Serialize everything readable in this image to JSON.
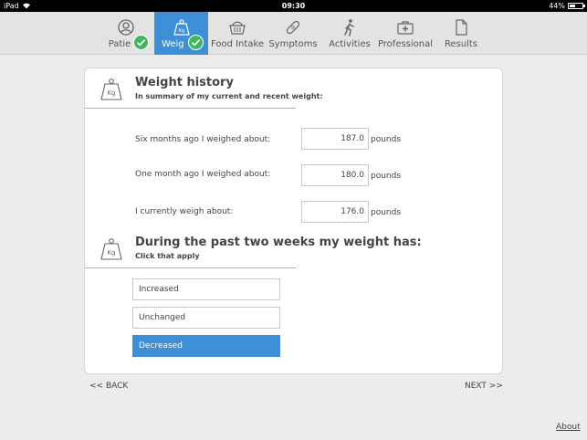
{
  "statusbar": {
    "device": "iPad",
    "time": "09:30",
    "battery": "44%"
  },
  "nav": {
    "tabs": [
      {
        "label": "Patie",
        "icon": "person-icon",
        "completed": true
      },
      {
        "label": "Weig",
        "icon": "weight-icon",
        "completed": true,
        "active": true
      },
      {
        "label": "Food Intake",
        "icon": "basket-icon"
      },
      {
        "label": "Symptoms",
        "icon": "bandage-icon"
      },
      {
        "label": "Activities",
        "icon": "walking-icon"
      },
      {
        "label": "Professional",
        "icon": "medical-kit-icon"
      },
      {
        "label": "Results",
        "icon": "document-icon"
      }
    ]
  },
  "weight_history": {
    "icon_text": "Kg",
    "title": "Weight history",
    "subtitle": "In summary of my current and recent weight:",
    "rows": [
      {
        "label": "Six months ago I weighed about:",
        "value": "187.0",
        "unit": "pounds"
      },
      {
        "label": "One month ago I weighed about:",
        "value": "180.0",
        "unit": "pounds"
      },
      {
        "label": "I currently weigh about:",
        "value": "176.0",
        "unit": "pounds"
      }
    ]
  },
  "weight_change": {
    "icon_text": "Kg",
    "title": "During the past two weeks my weight has:",
    "subtitle": "Click that apply",
    "options": [
      {
        "label": "Increased",
        "selected": false
      },
      {
        "label": "Unchanged",
        "selected": false
      },
      {
        "label": "Decreased",
        "selected": true
      }
    ]
  },
  "footer": {
    "back": "<< BACK",
    "next": "NEXT >>",
    "about": "About"
  },
  "colors": {
    "accent": "#3d8fd6",
    "check": "#3fb65b"
  }
}
